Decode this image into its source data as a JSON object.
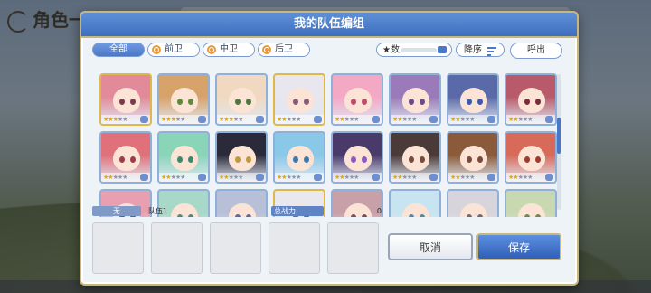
{
  "background": {
    "title": "角色一览"
  },
  "modal": {
    "title": "我的队伍编组"
  },
  "filter": {
    "tabs": [
      {
        "label": "全部",
        "active": true
      },
      {
        "label": "前卫",
        "active": false
      },
      {
        "label": "中卫",
        "active": false
      },
      {
        "label": "后卫",
        "active": false
      }
    ],
    "sort_label": "★数",
    "order_label": "降序",
    "call_label": "呼出"
  },
  "characters": [
    {
      "frame": "gold",
      "hair": "#e38a9a",
      "eye": "#7a3a4a",
      "stars": 3
    },
    {
      "frame": "blue",
      "hair": "#d8a36a",
      "eye": "#5a8a3a",
      "stars": 3
    },
    {
      "frame": "blue",
      "hair": "#f0d9c0",
      "eye": "#4a7a3a",
      "stars": 3
    },
    {
      "frame": "gold",
      "hair": "#e8e6ef",
      "eye": "#8a5a7a",
      "stars": 2
    },
    {
      "frame": "blue",
      "hair": "#f3a8c4",
      "eye": "#c04a6a",
      "stars": 2
    },
    {
      "frame": "blue",
      "hair": "#9a7ab8",
      "eye": "#6a4a8a",
      "stars": 2
    },
    {
      "frame": "blue",
      "hair": "#5a6aa8",
      "eye": "#3a5ab0",
      "stars": 2
    },
    {
      "frame": "blue",
      "hair": "#b85a6a",
      "eye": "#7a2a3a",
      "stars": 2
    },
    {
      "frame": "blue",
      "hair": "#e0707a",
      "eye": "#a03a4a",
      "stars": 2
    },
    {
      "frame": "blue",
      "hair": "#8ad4b8",
      "eye": "#3a8a6a",
      "stars": 2
    },
    {
      "frame": "blue",
      "hair": "#2a2a3a",
      "eye": "#c09a3a",
      "stars": 2
    },
    {
      "frame": "blue",
      "hair": "#8ac8e8",
      "eye": "#3a7ab0",
      "stars": 2
    },
    {
      "frame": "blue",
      "hair": "#4a3a6a",
      "eye": "#8a5ac0",
      "stars": 2
    },
    {
      "frame": "blue",
      "hair": "#4a3a38",
      "eye": "#7a4a3a",
      "stars": 2
    },
    {
      "frame": "blue",
      "hair": "#8a5a3a",
      "eye": "#7a4a3a",
      "stars": 2
    },
    {
      "frame": "blue",
      "hair": "#d86a5a",
      "eye": "#a03a2a",
      "stars": 2
    },
    {
      "frame": "blue",
      "hair": "#e8a0b0",
      "eye": "#a04a5a",
      "stars": 2
    },
    {
      "frame": "blue",
      "hair": "#a8d8c8",
      "eye": "#4a8a7a",
      "stars": 2
    },
    {
      "frame": "blue",
      "hair": "#b8c0d8",
      "eye": "#5a6a9a",
      "stars": 2
    },
    {
      "frame": "gold",
      "hair": "#e8e8ee",
      "eye": "#6a6a8a",
      "stars": 2
    },
    {
      "frame": "blue",
      "hair": "#c8a0a8",
      "eye": "#7a4a5a",
      "stars": 2
    },
    {
      "frame": "blue",
      "hair": "#c8e4f0",
      "eye": "#4a8ab0",
      "stars": 2
    },
    {
      "frame": "blue",
      "hair": "#d8d4dc",
      "eye": "#6a6a7a",
      "stars": 2
    },
    {
      "frame": "blue",
      "hair": "#c8d8b0",
      "eye": "#6a8a4a",
      "stars": 2
    }
  ],
  "party": {
    "tag": "无",
    "team_name": "队伍1",
    "power_label": "总战力",
    "power_value": "0",
    "slots": [
      "",
      "",
      "",
      "",
      ""
    ]
  },
  "buttons": {
    "cancel_label": "取消",
    "save_label": "保存"
  },
  "colors": {
    "header_blue": "#3e6fc0",
    "accent_gold": "#c9b67a",
    "star_gold": "#e2a31f"
  }
}
